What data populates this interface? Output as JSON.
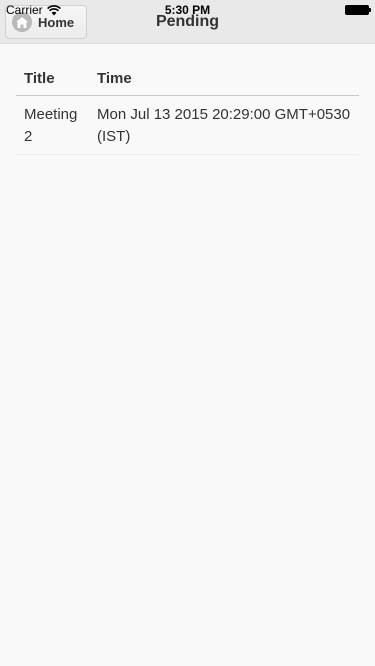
{
  "status_bar": {
    "carrier": "Carrier",
    "time": "5:30 PM"
  },
  "header": {
    "home_label": "Home",
    "title": "Pending"
  },
  "table": {
    "columns": [
      "Title",
      "Time"
    ],
    "rows": [
      {
        "title": "Meeting 2",
        "time": "Mon Jul 13 2015 20:29:00 GMT+0530 (IST)"
      }
    ]
  },
  "colors": {
    "background": "#f9f9f9",
    "header_bg": "#e9e9e9",
    "text": "#333333"
  },
  "icons": {
    "home": "home-icon",
    "wifi": "wifi-icon",
    "battery": "battery-icon"
  }
}
